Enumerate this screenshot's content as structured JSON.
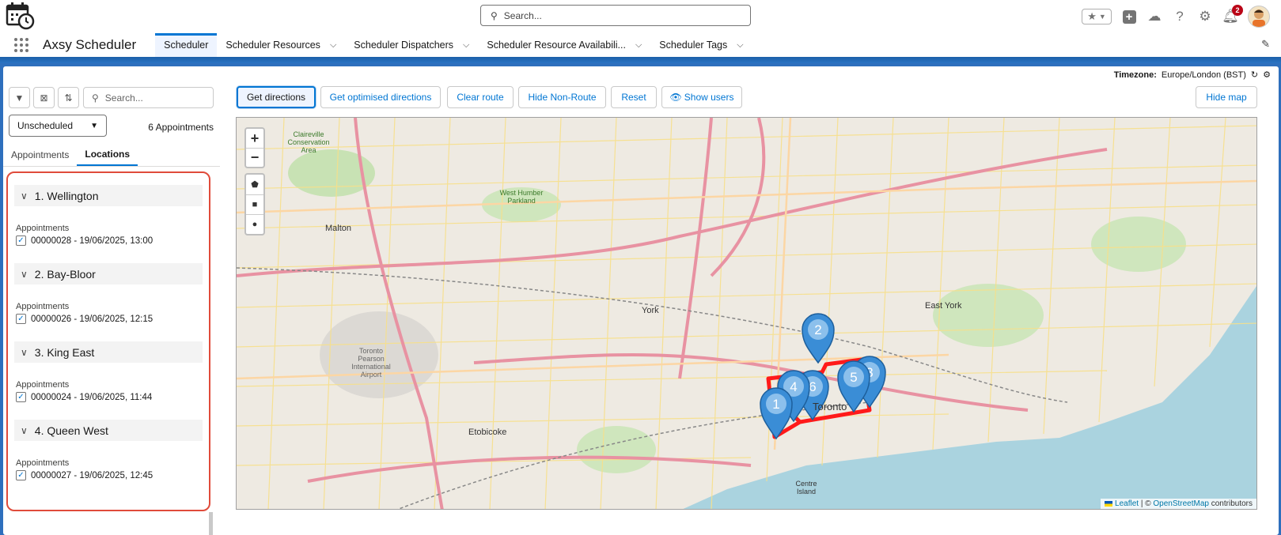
{
  "global_header": {
    "search_placeholder": "Search...",
    "notification_count": "2"
  },
  "nav": {
    "app_name": "Axsy Scheduler",
    "tabs": [
      {
        "label": "Scheduler",
        "active": true,
        "has_menu": false
      },
      {
        "label": "Scheduler Resources",
        "has_menu": true
      },
      {
        "label": "Scheduler Dispatchers",
        "has_menu": true
      },
      {
        "label": "Scheduler Resource Availabili...",
        "has_menu": true
      },
      {
        "label": "Scheduler Tags",
        "has_menu": true
      }
    ]
  },
  "timezone": {
    "label": "Timezone:",
    "value": "Europe/London (BST)"
  },
  "left_panel": {
    "search_placeholder": "Search...",
    "filter_select": "Unscheduled",
    "appointment_count": "6 Appointments",
    "tabs": [
      "Appointments",
      "Locations"
    ],
    "active_tab": "Locations",
    "locations": [
      {
        "title": "1. Wellington",
        "appointments_label": "Appointments",
        "appointment": "00000028 - 19/06/2025, 13:00"
      },
      {
        "title": "2. Bay-Bloor",
        "appointments_label": "Appointments",
        "appointment": "00000026 - 19/06/2025, 12:15"
      },
      {
        "title": "3. King East",
        "appointments_label": "Appointments",
        "appointment": "00000024 - 19/06/2025, 11:44"
      },
      {
        "title": "4. Queen West",
        "appointments_label": "Appointments",
        "appointment": "00000027 - 19/06/2025, 12:45"
      }
    ]
  },
  "toolbar": {
    "get_directions": "Get directions",
    "get_optimised": "Get optimised directions",
    "clear_route": "Clear route",
    "hide_non_route": "Hide Non-Route",
    "reset": "Reset",
    "show_users": "Show users",
    "hide_map": "Hide map"
  },
  "map": {
    "zoom_in": "+",
    "zoom_out": "−",
    "attribution_leaflet": "Leaflet",
    "attribution_sep": " | © ",
    "attribution_osm": "OpenStreetMap",
    "attribution_tail": " contributors",
    "place_labels": [
      "Claireville Conservation Area",
      "West Humber Parkland",
      "Malton",
      "York",
      "East York",
      "Toronto Pearson International Airport",
      "Etobicoke",
      "Toronto",
      "Centre Island"
    ],
    "markers": [
      "1",
      "2",
      "3",
      "4",
      "5",
      "6"
    ],
    "route_color": "#ff1a1a",
    "marker_color": "#3a8dd6"
  },
  "colors": {
    "accent": "#0176d3",
    "highlight_border": "#e04b3b"
  }
}
